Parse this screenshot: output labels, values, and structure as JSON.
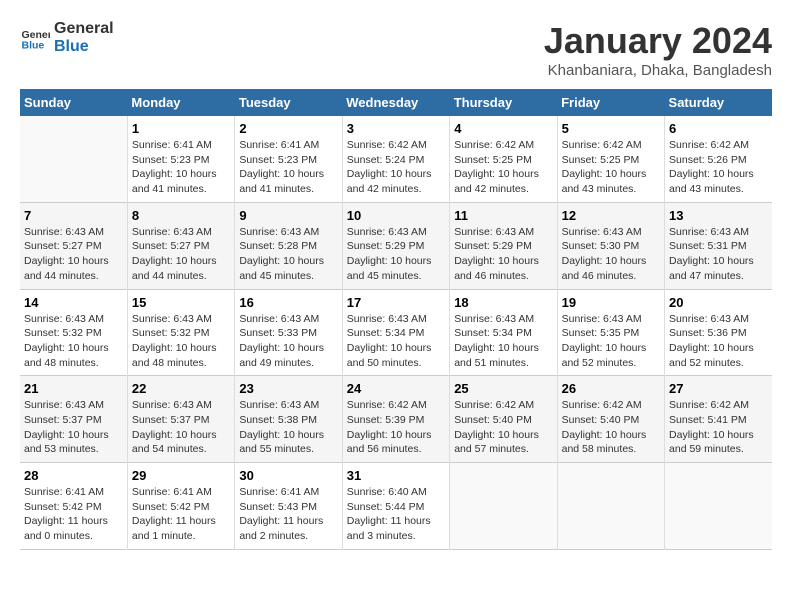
{
  "logo": {
    "line1": "General",
    "line2": "Blue"
  },
  "title": "January 2024",
  "subtitle": "Khanbaniara, Dhaka, Bangladesh",
  "weekdays": [
    "Sunday",
    "Monday",
    "Tuesday",
    "Wednesday",
    "Thursday",
    "Friday",
    "Saturday"
  ],
  "weeks": [
    [
      {
        "day": "",
        "info": ""
      },
      {
        "day": "1",
        "info": "Sunrise: 6:41 AM\nSunset: 5:23 PM\nDaylight: 10 hours\nand 41 minutes."
      },
      {
        "day": "2",
        "info": "Sunrise: 6:41 AM\nSunset: 5:23 PM\nDaylight: 10 hours\nand 41 minutes."
      },
      {
        "day": "3",
        "info": "Sunrise: 6:42 AM\nSunset: 5:24 PM\nDaylight: 10 hours\nand 42 minutes."
      },
      {
        "day": "4",
        "info": "Sunrise: 6:42 AM\nSunset: 5:25 PM\nDaylight: 10 hours\nand 42 minutes."
      },
      {
        "day": "5",
        "info": "Sunrise: 6:42 AM\nSunset: 5:25 PM\nDaylight: 10 hours\nand 43 minutes."
      },
      {
        "day": "6",
        "info": "Sunrise: 6:42 AM\nSunset: 5:26 PM\nDaylight: 10 hours\nand 43 minutes."
      }
    ],
    [
      {
        "day": "7",
        "info": "Sunrise: 6:43 AM\nSunset: 5:27 PM\nDaylight: 10 hours\nand 44 minutes."
      },
      {
        "day": "8",
        "info": "Sunrise: 6:43 AM\nSunset: 5:27 PM\nDaylight: 10 hours\nand 44 minutes."
      },
      {
        "day": "9",
        "info": "Sunrise: 6:43 AM\nSunset: 5:28 PM\nDaylight: 10 hours\nand 45 minutes."
      },
      {
        "day": "10",
        "info": "Sunrise: 6:43 AM\nSunset: 5:29 PM\nDaylight: 10 hours\nand 45 minutes."
      },
      {
        "day": "11",
        "info": "Sunrise: 6:43 AM\nSunset: 5:29 PM\nDaylight: 10 hours\nand 46 minutes."
      },
      {
        "day": "12",
        "info": "Sunrise: 6:43 AM\nSunset: 5:30 PM\nDaylight: 10 hours\nand 46 minutes."
      },
      {
        "day": "13",
        "info": "Sunrise: 6:43 AM\nSunset: 5:31 PM\nDaylight: 10 hours\nand 47 minutes."
      }
    ],
    [
      {
        "day": "14",
        "info": "Sunrise: 6:43 AM\nSunset: 5:32 PM\nDaylight: 10 hours\nand 48 minutes."
      },
      {
        "day": "15",
        "info": "Sunrise: 6:43 AM\nSunset: 5:32 PM\nDaylight: 10 hours\nand 48 minutes."
      },
      {
        "day": "16",
        "info": "Sunrise: 6:43 AM\nSunset: 5:33 PM\nDaylight: 10 hours\nand 49 minutes."
      },
      {
        "day": "17",
        "info": "Sunrise: 6:43 AM\nSunset: 5:34 PM\nDaylight: 10 hours\nand 50 minutes."
      },
      {
        "day": "18",
        "info": "Sunrise: 6:43 AM\nSunset: 5:34 PM\nDaylight: 10 hours\nand 51 minutes."
      },
      {
        "day": "19",
        "info": "Sunrise: 6:43 AM\nSunset: 5:35 PM\nDaylight: 10 hours\nand 52 minutes."
      },
      {
        "day": "20",
        "info": "Sunrise: 6:43 AM\nSunset: 5:36 PM\nDaylight: 10 hours\nand 52 minutes."
      }
    ],
    [
      {
        "day": "21",
        "info": "Sunrise: 6:43 AM\nSunset: 5:37 PM\nDaylight: 10 hours\nand 53 minutes."
      },
      {
        "day": "22",
        "info": "Sunrise: 6:43 AM\nSunset: 5:37 PM\nDaylight: 10 hours\nand 54 minutes."
      },
      {
        "day": "23",
        "info": "Sunrise: 6:43 AM\nSunset: 5:38 PM\nDaylight: 10 hours\nand 55 minutes."
      },
      {
        "day": "24",
        "info": "Sunrise: 6:42 AM\nSunset: 5:39 PM\nDaylight: 10 hours\nand 56 minutes."
      },
      {
        "day": "25",
        "info": "Sunrise: 6:42 AM\nSunset: 5:40 PM\nDaylight: 10 hours\nand 57 minutes."
      },
      {
        "day": "26",
        "info": "Sunrise: 6:42 AM\nSunset: 5:40 PM\nDaylight: 10 hours\nand 58 minutes."
      },
      {
        "day": "27",
        "info": "Sunrise: 6:42 AM\nSunset: 5:41 PM\nDaylight: 10 hours\nand 59 minutes."
      }
    ],
    [
      {
        "day": "28",
        "info": "Sunrise: 6:41 AM\nSunset: 5:42 PM\nDaylight: 11 hours\nand 0 minutes."
      },
      {
        "day": "29",
        "info": "Sunrise: 6:41 AM\nSunset: 5:42 PM\nDaylight: 11 hours\nand 1 minute."
      },
      {
        "day": "30",
        "info": "Sunrise: 6:41 AM\nSunset: 5:43 PM\nDaylight: 11 hours\nand 2 minutes."
      },
      {
        "day": "31",
        "info": "Sunrise: 6:40 AM\nSunset: 5:44 PM\nDaylight: 11 hours\nand 3 minutes."
      },
      {
        "day": "",
        "info": ""
      },
      {
        "day": "",
        "info": ""
      },
      {
        "day": "",
        "info": ""
      }
    ]
  ]
}
